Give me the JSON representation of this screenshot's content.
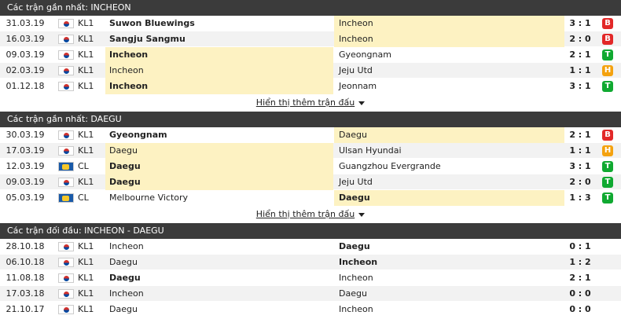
{
  "sections": [
    {
      "title": "Các trận gần nhất: INCHEON",
      "more": "Hiển thị thêm trận đấu",
      "rows": [
        {
          "date": "31.03.19",
          "flag": "kr",
          "league": "KL1",
          "home": "Suwon Bluewings",
          "away": "Incheon",
          "score": "3 : 1",
          "result": "B",
          "home_bold": true,
          "away_bold": false,
          "hl": "away"
        },
        {
          "date": "16.03.19",
          "flag": "kr",
          "league": "KL1",
          "home": "Sangju Sangmu",
          "away": "Incheon",
          "score": "2 : 0",
          "result": "B",
          "home_bold": true,
          "away_bold": false,
          "hl": "away"
        },
        {
          "date": "09.03.19",
          "flag": "kr",
          "league": "KL1",
          "home": "Incheon",
          "away": "Gyeongnam",
          "score": "2 : 1",
          "result": "T",
          "home_bold": true,
          "away_bold": false,
          "hl": "home"
        },
        {
          "date": "02.03.19",
          "flag": "kr",
          "league": "KL1",
          "home": "Incheon",
          "away": "Jeju Utd",
          "score": "1 : 1",
          "result": "H",
          "home_bold": false,
          "away_bold": false,
          "hl": "home"
        },
        {
          "date": "01.12.18",
          "flag": "kr",
          "league": "KL1",
          "home": "Incheon",
          "away": "Jeonnam",
          "score": "3 : 1",
          "result": "T",
          "home_bold": true,
          "away_bold": false,
          "hl": "home"
        }
      ]
    },
    {
      "title": "Các trận gần nhất: DAEGU",
      "more": "Hiển thị thêm trận đấu",
      "rows": [
        {
          "date": "30.03.19",
          "flag": "kr",
          "league": "KL1",
          "home": "Gyeongnam",
          "away": "Daegu",
          "score": "2 : 1",
          "result": "B",
          "home_bold": true,
          "away_bold": false,
          "hl": "away"
        },
        {
          "date": "17.03.19",
          "flag": "kr",
          "league": "KL1",
          "home": "Daegu",
          "away": "Ulsan Hyundai",
          "score": "1 : 1",
          "result": "H",
          "home_bold": false,
          "away_bold": false,
          "hl": "home"
        },
        {
          "date": "12.03.19",
          "flag": "cl",
          "league": "CL",
          "home": "Daegu",
          "away": "Guangzhou Evergrande",
          "score": "3 : 1",
          "result": "T",
          "home_bold": true,
          "away_bold": false,
          "hl": "home"
        },
        {
          "date": "09.03.19",
          "flag": "kr",
          "league": "KL1",
          "home": "Daegu",
          "away": "Jeju Utd",
          "score": "2 : 0",
          "result": "T",
          "home_bold": true,
          "away_bold": false,
          "hl": "home"
        },
        {
          "date": "05.03.19",
          "flag": "cl",
          "league": "CL",
          "home": "Melbourne Victory",
          "away": "Daegu",
          "score": "1 : 3",
          "result": "T",
          "home_bold": false,
          "away_bold": true,
          "hl": "away"
        }
      ]
    },
    {
      "title": "Các trận đối đầu: INCHEON - DAEGU",
      "more": "",
      "rows": [
        {
          "date": "28.10.18",
          "flag": "kr",
          "league": "KL1",
          "home": "Incheon",
          "away": "Daegu",
          "score": "0 : 1",
          "result": "",
          "home_bold": false,
          "away_bold": true,
          "hl": ""
        },
        {
          "date": "06.10.18",
          "flag": "kr",
          "league": "KL1",
          "home": "Daegu",
          "away": "Incheon",
          "score": "1 : 2",
          "result": "",
          "home_bold": false,
          "away_bold": true,
          "hl": ""
        },
        {
          "date": "11.08.18",
          "flag": "kr",
          "league": "KL1",
          "home": "Daegu",
          "away": "Incheon",
          "score": "2 : 1",
          "result": "",
          "home_bold": true,
          "away_bold": false,
          "hl": ""
        },
        {
          "date": "17.03.18",
          "flag": "kr",
          "league": "KL1",
          "home": "Incheon",
          "away": "Daegu",
          "score": "0 : 0",
          "result": "",
          "home_bold": false,
          "away_bold": false,
          "hl": ""
        },
        {
          "date": "21.10.17",
          "flag": "kr",
          "league": "KL1",
          "home": "Daegu",
          "away": "Incheon",
          "score": "0 : 0",
          "result": "",
          "home_bold": false,
          "away_bold": false,
          "hl": ""
        }
      ]
    }
  ],
  "colors": {
    "header_bg": "#3b3b3b",
    "highlight": "#fdf2c2",
    "loss": "#e22828",
    "win": "#10a931",
    "draw": "#f4a20f"
  },
  "icons": {
    "kr": "south-korea-flag-icon",
    "cl": "champions-league-flag-icon",
    "more": "caret-down-icon"
  }
}
